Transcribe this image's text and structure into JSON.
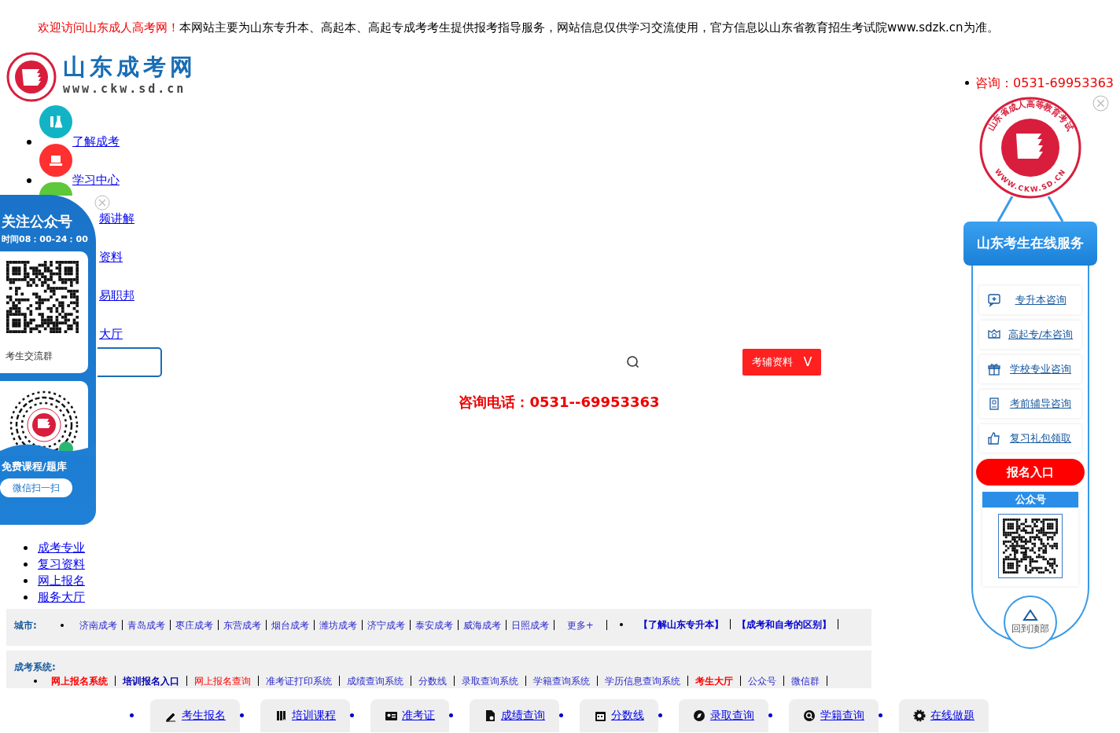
{
  "notice": {
    "highlight": "欢迎访问山东成人高考网！",
    "text": "本网站主要为山东专升本、高起本、高起专成考考生提供报考指导服务，网站信息仅供学习交流使用，官方信息以山东省教育招生考试院www.sdzk.cn为准。"
  },
  "logo": {
    "title": "山东成考网",
    "url": "www.ckw.sd.cn"
  },
  "contact": "咨询：0531-69953363",
  "nav": [
    {
      "label": "了解成考",
      "kind": "icon"
    },
    {
      "label": "学习中心",
      "kind": "icon"
    },
    {
      "label": "频讲解",
      "kind": "covered"
    },
    {
      "label": "资料",
      "kind": "plain"
    },
    {
      "label": "易职邦",
      "kind": "plain"
    },
    {
      "label": "大厅",
      "kind": "plain"
    }
  ],
  "search": {
    "button": "考辅资料",
    "caret": "V"
  },
  "phone": "咨询电话：0531--69953363",
  "links": [
    "成考专业",
    "复习资料",
    "网上报名",
    "服务大厅"
  ],
  "cities": {
    "label": "城市:",
    "items": [
      "济南成考",
      "青岛成考",
      "枣庄成考",
      "东营成考",
      "烟台成考",
      "潍坊成考",
      "济宁成考",
      "泰安成考",
      "威海成考",
      "日照成考"
    ],
    "more": "更多+",
    "extras": [
      "【了解山东专升本】",
      "【成考和自考的区别】"
    ]
  },
  "systems": {
    "label": "成考系统:",
    "items": [
      {
        "label": "网上报名系统",
        "kind": "alert",
        "bold": true
      },
      {
        "label": "培训报名入口",
        "kind": "strong",
        "bold": true
      },
      {
        "label": "网上报名查询",
        "kind": "alert",
        "bold": false
      },
      {
        "label": "准考证打印系统",
        "kind": "normal",
        "bold": false
      },
      {
        "label": "成绩查询系统",
        "kind": "normal",
        "bold": false
      },
      {
        "label": "分数线",
        "kind": "normal",
        "bold": false
      },
      {
        "label": "录取查询系统",
        "kind": "normal",
        "bold": false
      },
      {
        "label": "学籍查询系统",
        "kind": "normal",
        "bold": false
      },
      {
        "label": "学历信息查询系统",
        "kind": "normal",
        "bold": false
      },
      {
        "label": "考生大厅",
        "kind": "alert",
        "bold": true
      },
      {
        "label": "公众号",
        "kind": "normal",
        "bold": false
      },
      {
        "label": "微信群",
        "kind": "normal",
        "bold": false
      }
    ]
  },
  "quick_links": [
    "考生报名",
    "培训课程",
    "准考证",
    "成绩查询",
    "分数线",
    "录取查询",
    "学籍查询",
    "在线做题"
  ],
  "left_panel": {
    "title": "关注公众号",
    "hours": "时间08：00-24：00",
    "qr_caption": "考生交流群",
    "promo": "免费课程/题库",
    "button": "微信扫一扫"
  },
  "right_panel": {
    "seal_top": "山东省成人高等教育考试",
    "seal_bottom": "WWW.CKW.SD.CN",
    "title": "山东考生在线服务",
    "items": [
      "专升本咨询",
      "高起专/本咨询",
      "学校专业咨询",
      "考前辅导咨询",
      "复习礼包领取"
    ],
    "signup": "报名入口",
    "qr_title": "公众号",
    "back_top": "回到顶部"
  }
}
